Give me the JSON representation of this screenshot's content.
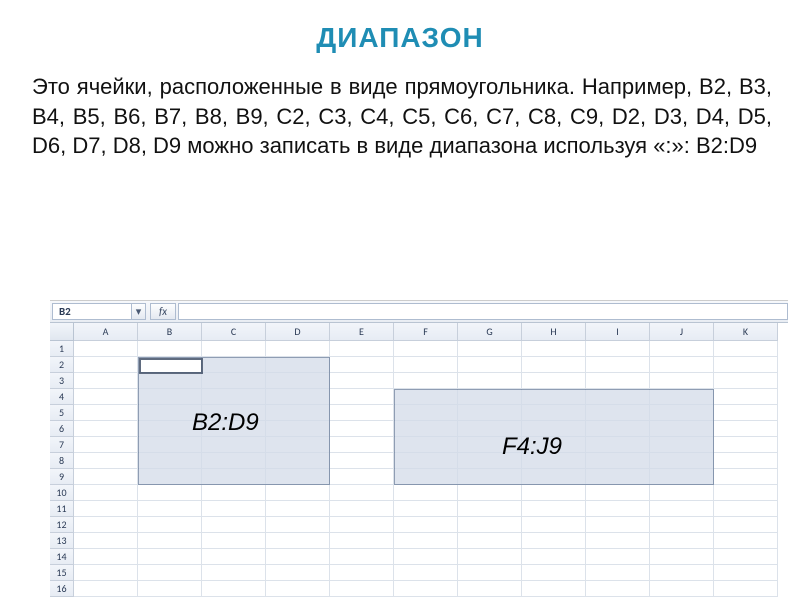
{
  "title": "ДИАПАЗОН",
  "paragraph": "Это ячейки, расположенные в виде прямоугольника. Например, В2, В3, В4, В5, В6, В7, В8, В9, С2, С3, С4, С5, С6, С7, С8, С9, D2, D3, D4, D5, D6, D7, D8, D9 можно записать в виде диапазона используя «:»: B2:D9",
  "excel": {
    "namebox_value": "B2",
    "fx_label": "fx",
    "dropdown_glyph": "▾",
    "columns": [
      "A",
      "B",
      "C",
      "D",
      "E",
      "F",
      "G",
      "H",
      "I",
      "J",
      "K"
    ],
    "rows": [
      "1",
      "2",
      "3",
      "4",
      "5",
      "6",
      "7",
      "8",
      "9",
      "10",
      "11",
      "12",
      "13",
      "14",
      "15",
      "16"
    ],
    "selection1_label": "B2:D9",
    "selection2_label": "F4:J9"
  }
}
